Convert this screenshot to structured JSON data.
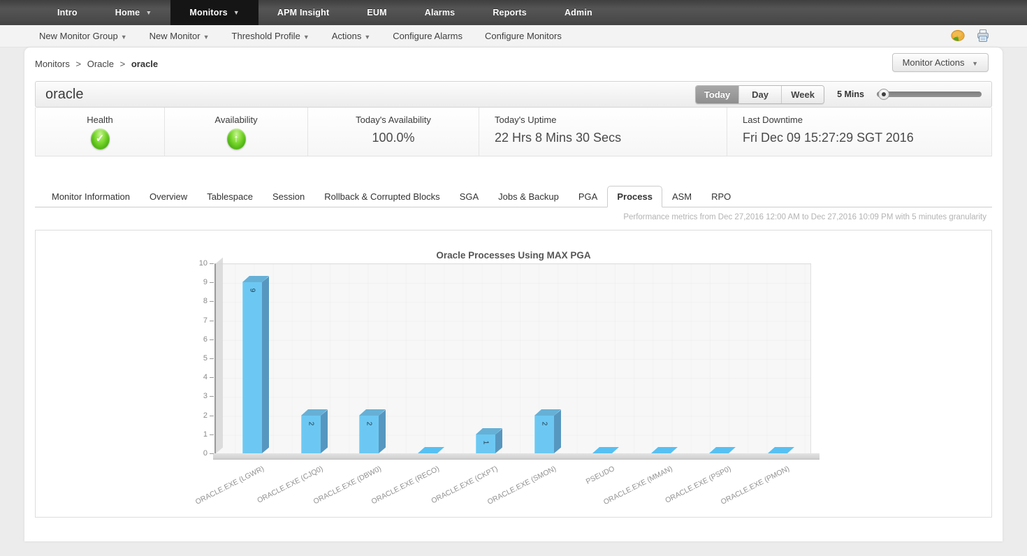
{
  "nav": {
    "items": [
      {
        "label": "Intro",
        "chevron": false,
        "active": false
      },
      {
        "label": "Home",
        "chevron": true,
        "active": false
      },
      {
        "label": "Monitors",
        "chevron": true,
        "active": true
      },
      {
        "label": "APM Insight",
        "chevron": false,
        "active": false
      },
      {
        "label": "EUM",
        "chevron": false,
        "active": false
      },
      {
        "label": "Alarms",
        "chevron": false,
        "active": false
      },
      {
        "label": "Reports",
        "chevron": false,
        "active": false
      },
      {
        "label": "Admin",
        "chevron": false,
        "active": false
      }
    ]
  },
  "toolbar": {
    "items": [
      {
        "label": "New Monitor Group",
        "dropdown": true
      },
      {
        "label": "New Monitor",
        "dropdown": true
      },
      {
        "label": "Threshold Profile",
        "dropdown": true
      },
      {
        "label": "Actions",
        "dropdown": true
      },
      {
        "label": "Configure Alarms",
        "dropdown": false
      },
      {
        "label": "Configure Monitors",
        "dropdown": false
      }
    ],
    "icons": [
      {
        "name": "pie-chart-icon"
      },
      {
        "name": "print-icon"
      }
    ]
  },
  "breadcrumb": {
    "link1": "Monitors",
    "link2": "Oracle",
    "current": "oracle",
    "separator": ">"
  },
  "monitor_actions_label": "Monitor Actions",
  "titlebar": {
    "title": "oracle",
    "ranges": [
      {
        "label": "Today",
        "active": true
      },
      {
        "label": "Day",
        "active": false
      },
      {
        "label": "Week",
        "active": false
      }
    ],
    "interval": "5 Mins"
  },
  "stats": {
    "cells": [
      {
        "label": "Health",
        "icon": "check-badge-icon",
        "glyph": "✓",
        "align": "center"
      },
      {
        "label": "Availability",
        "icon": "up-arrow-badge-icon",
        "glyph": "↑",
        "align": "center"
      },
      {
        "label": "Today's Availability",
        "value": "100.0%",
        "align": "center"
      },
      {
        "label": "Today's Uptime",
        "value": "22 Hrs 8 Mins 30 Secs",
        "align": "left"
      },
      {
        "label": "Last Downtime",
        "value": "Fri Dec 09 15:27:29 SGT 2016",
        "align": "left"
      }
    ]
  },
  "tabs": {
    "items": [
      "Monitor Information",
      "Overview",
      "Tablespace",
      "Session",
      "Rollback & Corrupted Blocks",
      "SGA",
      "Jobs & Backup",
      "PGA",
      "Process",
      "ASM",
      "RPO"
    ],
    "active": "Process"
  },
  "metrics_note": "Performance metrics from Dec 27,2016 12:00 AM to Dec 27,2016 10:09 PM with 5 minutes granularity",
  "chart_data": {
    "type": "bar",
    "style": "3d-column",
    "title": "Oracle Processes Using MAX PGA",
    "categories": [
      "ORACLE.EXE (LGWR)",
      "ORACLE.EXE (CJQ0)",
      "ORACLE.EXE (DBW0)",
      "ORACLE.EXE (RECO)",
      "ORACLE.EXE (CKPT)",
      "ORACLE.EXE (SMON)",
      "PSEUDO",
      "ORACLE.EXE (MMAN)",
      "ORACLE.EXE (PSP0)",
      "ORACLE.EXE (PMON)"
    ],
    "values": [
      9,
      2,
      2,
      0,
      1,
      2,
      0,
      0,
      0,
      0
    ],
    "xlabel": "",
    "ylabel": "",
    "ylim": [
      0,
      10
    ],
    "ytick_step": 1,
    "grid": true,
    "legend_position": "none",
    "colors": {
      "bar_front": "#6cc8f2",
      "bar_side": "#5697c0",
      "bar_top": "#66b0d6",
      "zero_face": "#57c0f2"
    }
  }
}
